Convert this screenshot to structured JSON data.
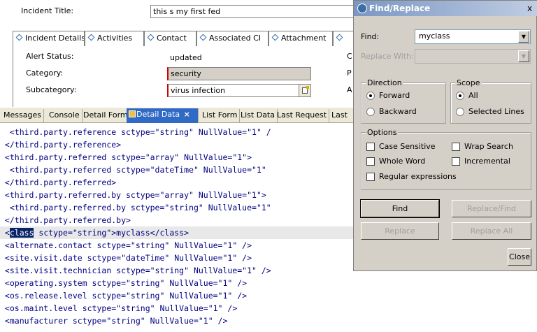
{
  "form": {
    "title_label": "Incident Title:",
    "title_value": "this s my first fed",
    "tabs": [
      "Incident Details",
      "Activities",
      "Contact",
      "Associated CI",
      "Attachment",
      ""
    ],
    "alert_status_label": "Alert Status:",
    "alert_status_value": "updated",
    "category_label": "Category:",
    "category_value": "security",
    "subcategory_label": "Subcategory:",
    "subcategory_value": "virus infection",
    "right_letters": [
      "C",
      "P",
      "A"
    ]
  },
  "view_tabs": {
    "items": [
      "Messages",
      "Console",
      "Detail Form",
      "Detail Data",
      "List Form",
      "List Data",
      "Last Request",
      "Last"
    ],
    "active_close": "×"
  },
  "code": {
    "lines": [
      "  <third.party.reference sctype=\"string\" NullValue=\"1\" /",
      " </third.party.reference>",
      " <third.party.referred sctype=\"array\" NullValue=\"1\">",
      "  <third.party.referred sctype=\"dateTime\" NullValue=\"1\"",
      " </third.party.referred>",
      " <third.party.referred.by sctype=\"array\" NullValue=\"1\">",
      "  <third.party.referred.by sctype=\"string\" NullValue=\"1\"",
      " </third.party.referred.by>",
      "",
      " <alternate.contact sctype=\"string\" NullValue=\"1\" />",
      " <site.visit.date sctype=\"dateTime\" NullValue=\"1\" />",
      " <site.visit.technician sctype=\"string\" NullValue=\"1\" />",
      " <operating.system sctype=\"string\" NullValue=\"1\" />",
      " <os.release.level sctype=\"string\" NullValue=\"1\" />",
      " <os.maint.level sctype=\"string\" NullValue=\"1\" />",
      " <manufacturer sctype=\"string\" NullValue=\"1\" />"
    ],
    "hl_pre": " <",
    "hl_selected": "class",
    "hl_post": " sctype=\"string\">myclass</class>"
  },
  "dialog": {
    "title": "Find/Replace",
    "close_x": "x",
    "find_label": "Find:",
    "find_value": "myclass",
    "replace_label": "Replace With:",
    "replace_value": "",
    "direction_title": "Direction",
    "forward": "Forward",
    "backward": "Backward",
    "scope_title": "Scope",
    "all": "All",
    "selected_lines": "Selected Lines",
    "options_title": "Options",
    "case_sensitive": "Case Sensitive",
    "wrap_search": "Wrap Search",
    "whole_word": "Whole Word",
    "incremental": "Incremental",
    "regex": "Regular expressions",
    "find_btn": "Find",
    "replace_find_btn": "Replace/Find",
    "replace_btn": "Replace",
    "replace_all_btn": "Replace All",
    "close_btn": "Close"
  },
  "icons": {
    "tab_diamond": "diamond-icon",
    "dropdown": "chevron-down-icon",
    "lookup": "lookup-icon",
    "detail_data": "data-icon",
    "dialog": "find-replace-icon"
  }
}
